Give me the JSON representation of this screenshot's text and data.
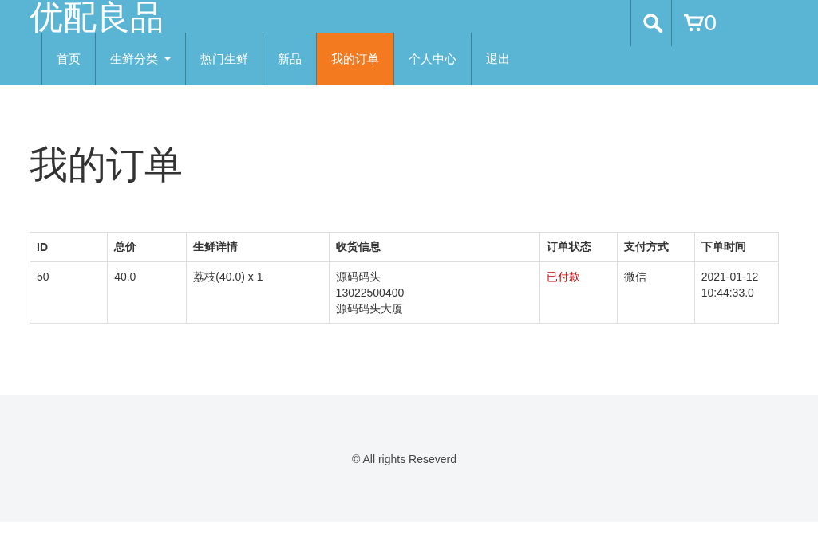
{
  "header": {
    "logo": "优配良品",
    "cart_count": "0"
  },
  "nav": [
    {
      "label": "首页",
      "selected": false,
      "dropdown": false
    },
    {
      "label": "生鲜分类",
      "selected": false,
      "dropdown": true
    },
    {
      "label": "热门生鲜",
      "selected": false,
      "dropdown": false
    },
    {
      "label": "新品",
      "selected": false,
      "dropdown": false
    },
    {
      "label": "我的订单",
      "selected": true,
      "dropdown": false
    },
    {
      "label": "个人中心",
      "selected": false,
      "dropdown": false
    },
    {
      "label": "退出",
      "selected": false,
      "dropdown": false
    }
  ],
  "page_title": "我的订单",
  "table": {
    "columns": [
      "ID",
      "总价",
      "生鲜详情",
      "收货信息",
      "订单状态",
      "支付方式",
      "下单时间"
    ],
    "rows": [
      {
        "cells": [
          {
            "kind": "text",
            "lines": [
              "50"
            ]
          },
          {
            "kind": "text",
            "lines": [
              "40.0"
            ]
          },
          {
            "kind": "text",
            "lines": [
              "荔枝(40.0) x 1"
            ]
          },
          {
            "kind": "text",
            "lines": [
              "源码码头",
              "13022500400",
              "源码码头大厦"
            ]
          },
          {
            "kind": "status",
            "lines": [
              "已付款"
            ]
          },
          {
            "kind": "text",
            "lines": [
              "微信"
            ]
          },
          {
            "kind": "text",
            "lines": [
              "2021-01-12 10:44:33.0"
            ]
          }
        ]
      }
    ]
  },
  "footer": {
    "text": "© All rights Reseverd"
  }
}
